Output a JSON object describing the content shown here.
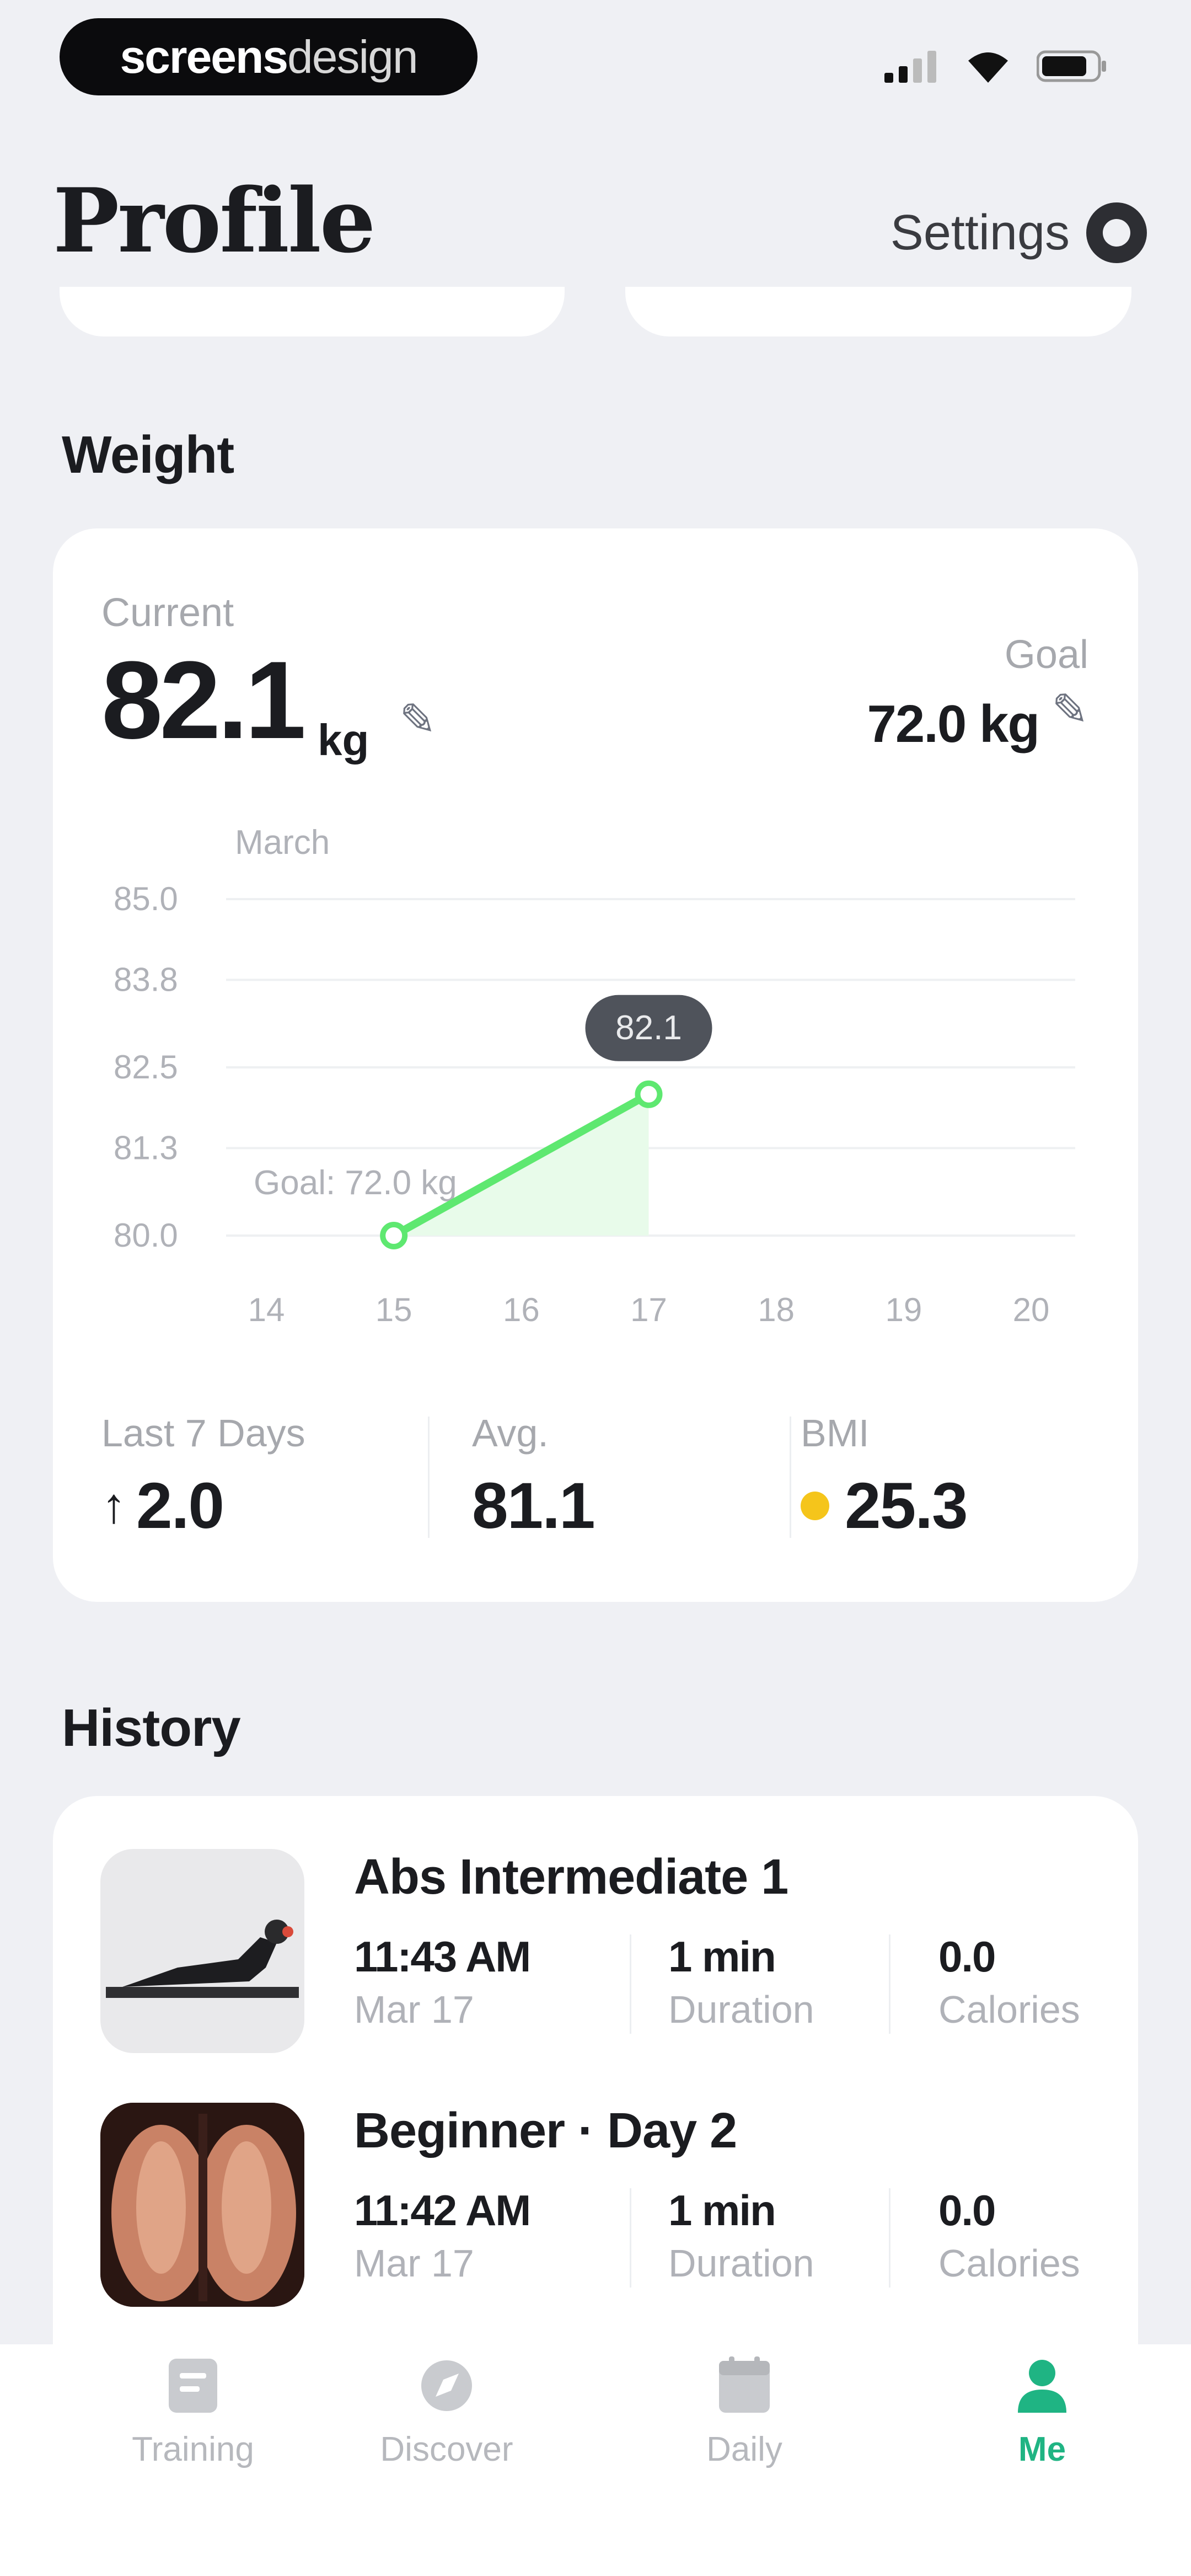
{
  "status_bar": {
    "brand_bold": "screens",
    "brand_light": "design",
    "icons": [
      "signal-icon",
      "wifi-icon",
      "battery-icon"
    ]
  },
  "header": {
    "title": "Profile",
    "settings_label": "Settings",
    "settings_icon": "gear-icon"
  },
  "weight": {
    "section_title": "Weight",
    "current_label": "Current",
    "current_value": "82.1",
    "current_unit": "kg",
    "goal_label": "Goal",
    "goal_value": "72.0 kg",
    "stats": [
      {
        "label": "Last 7 Days",
        "value": "2.0",
        "icon": "arrow-up-icon"
      },
      {
        "label": "Avg.",
        "value": "81.1"
      },
      {
        "label": "BMI",
        "value": "25.3",
        "icon": "yellow-dot"
      }
    ]
  },
  "chart_data": {
    "type": "line",
    "title": "March",
    "y_ticks": [
      "85.0",
      "83.8",
      "82.5",
      "81.3",
      "80.0"
    ],
    "ylim": [
      80.0,
      85.0
    ],
    "x_ticks": [
      "14",
      "15",
      "16",
      "17",
      "18",
      "19",
      "20"
    ],
    "series": [
      {
        "x": [
          15,
          17
        ],
        "y": [
          80.0,
          82.1
        ]
      }
    ],
    "tooltip": "82.1",
    "goal_annotation": "Goal: 72.0 kg",
    "line_color": "#5ee870"
  },
  "history": {
    "section_title": "History",
    "items": [
      {
        "title": "Abs Intermediate 1",
        "time": "11:43 AM",
        "date": "Mar 17",
        "duration": "1 min",
        "duration_label": "Duration",
        "calories": "0.0",
        "calories_label": "Calories",
        "thumb": "plank-photo"
      },
      {
        "title": "Beginner · Day 2",
        "time": "11:42 AM",
        "date": "Mar 17",
        "duration": "1 min",
        "duration_label": "Duration",
        "calories": "0.0",
        "calories_label": "Calories",
        "thumb": "arms-photo"
      }
    ]
  },
  "tabbar": {
    "tabs": [
      {
        "label": "Training",
        "icon": "training-icon"
      },
      {
        "label": "Discover",
        "icon": "compass-icon"
      },
      {
        "label": "Daily",
        "icon": "calendar-icon"
      },
      {
        "label": "Me",
        "icon": "person-icon",
        "active": true
      }
    ],
    "active_color": "#1fb483"
  }
}
